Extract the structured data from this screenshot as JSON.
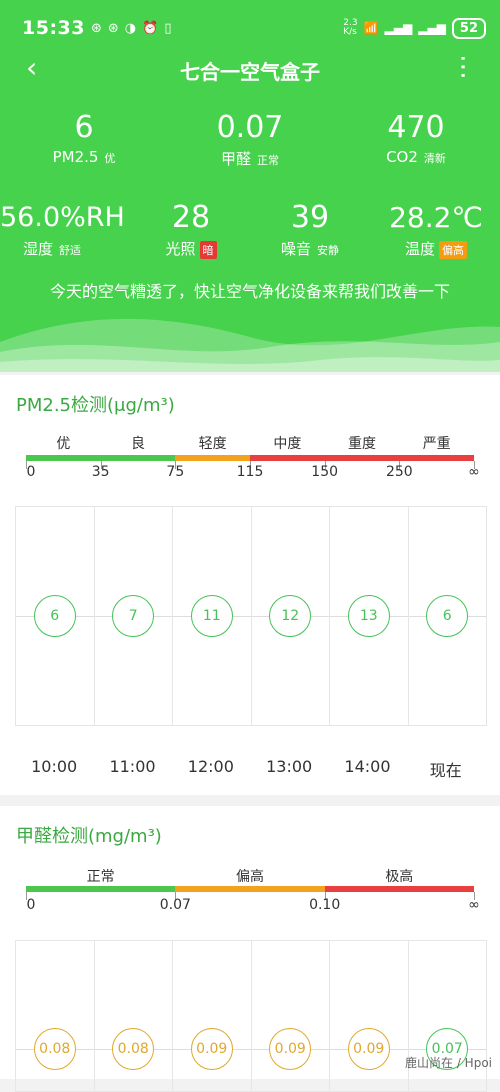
{
  "status_bar": {
    "time": "15:33",
    "net_speed": "2.3\nK/s",
    "battery": "52"
  },
  "header": {
    "title": "七合一空气盒子"
  },
  "metrics": [
    {
      "value": "6",
      "label": "PM2.5",
      "sub": "优"
    },
    {
      "value": "0.07",
      "label": "甲醛",
      "sub": "正常"
    },
    {
      "value": "470",
      "label": "CO2",
      "sub": "清新"
    },
    {
      "value": "56.0%RH",
      "label": "湿度",
      "sub": "舒适"
    },
    {
      "value": "28",
      "label": "光照",
      "tag": "暗"
    },
    {
      "value": "39",
      "label": "噪音",
      "sub": "安静"
    },
    {
      "value": "28.2℃",
      "label": "温度",
      "tag": "偏高"
    }
  ],
  "notice": "今天的空气糟透了，快让空气净化设备来帮我们改善一下",
  "pm25": {
    "title": "PM2.5检测(μg/m³)",
    "levels": [
      "优",
      "良",
      "轻度",
      "中度",
      "重度",
      "严重"
    ],
    "level_colors": [
      "#4cc74e",
      "#4cc74e",
      "#f2a21c",
      "#e84040",
      "#e84040",
      "#e84040"
    ],
    "ticks": [
      "0",
      "35",
      "75",
      "115",
      "150",
      "250",
      "∞"
    ],
    "times": [
      "10:00",
      "11:00",
      "12:00",
      "13:00",
      "14:00",
      "现在"
    ],
    "values": [
      6,
      7,
      11,
      12,
      13,
      6
    ]
  },
  "formaldehyde": {
    "title": "甲醛检测(mg/m³)",
    "levels": [
      "正常",
      "偏高",
      "极高"
    ],
    "level_colors": [
      "#4cc74e",
      "#f2a21c",
      "#e84040"
    ],
    "ticks": [
      "0",
      "0.07",
      "0.10",
      "∞"
    ],
    "values": [
      "0.08",
      "0.08",
      "0.09",
      "0.09",
      "0.09",
      "0.07"
    ]
  },
  "watermark": "鹿山尚在 / Hpoi"
}
